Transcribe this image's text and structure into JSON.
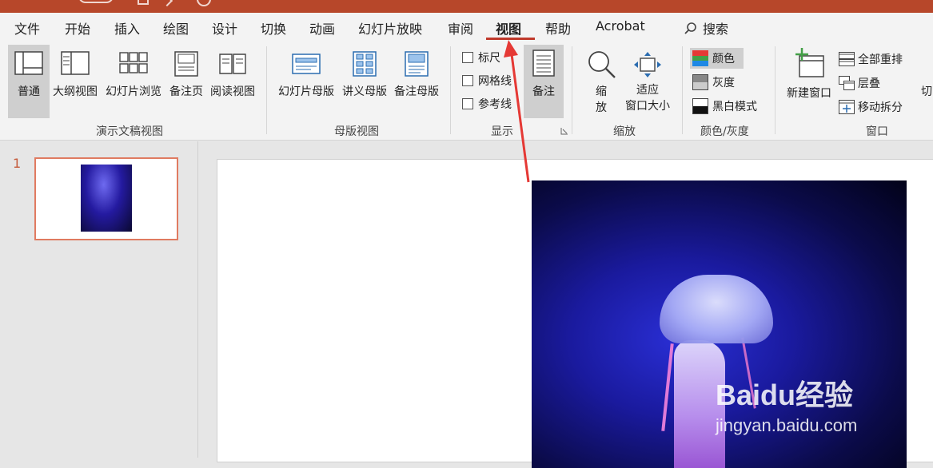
{
  "tabs": {
    "file": "文件",
    "home": "开始",
    "insert": "插入",
    "draw": "绘图",
    "design": "设计",
    "transitions": "切换",
    "animations": "动画",
    "slideshow": "幻灯片放映",
    "review": "审阅",
    "view": "视图",
    "help": "帮助",
    "acrobat": "Acrobat",
    "search": "搜索"
  },
  "ribbon": {
    "presentation_views": {
      "normal": "普通",
      "outline": "大纲视图",
      "sorter": "幻灯片浏览",
      "notes_page": "备注页",
      "reading": "阅读视图",
      "label": "演示文稿视图"
    },
    "master_views": {
      "slide_master": "幻灯片母版",
      "handout_master": "讲义母版",
      "notes_master": "备注母版",
      "label": "母版视图"
    },
    "show": {
      "ruler": "标尺",
      "gridlines": "网格线",
      "guides": "参考线",
      "notes": "备注",
      "label": "显示"
    },
    "zoom": {
      "zoom_line1": "缩",
      "zoom_line2": "放",
      "fit_line1": "适应",
      "fit_line2": "窗口大小",
      "label": "缩放"
    },
    "color": {
      "color": "颜色",
      "grayscale": "灰度",
      "bw": "黑白模式",
      "label": "颜色/灰度"
    },
    "window": {
      "new_window": "新建窗口",
      "arrange_all": "全部重排",
      "cascade": "层叠",
      "move_split": "移动拆分",
      "switch": "切",
      "label": "窗口"
    }
  },
  "thumbnails": {
    "slide_number": "1"
  },
  "watermark": {
    "brand": "Baidu经验",
    "url": "jingyan.baidu.com"
  }
}
